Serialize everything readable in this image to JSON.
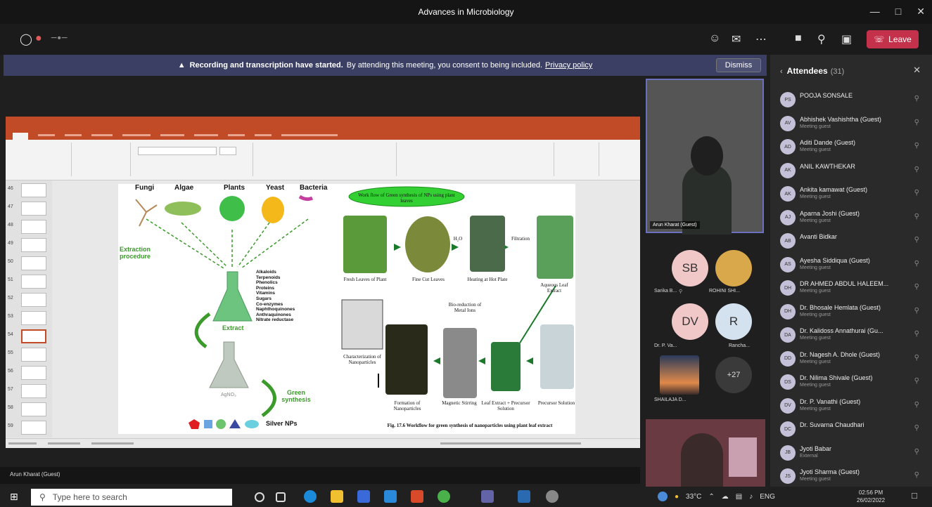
{
  "window": {
    "title": "Advances in Microbiology"
  },
  "toolbar": {
    "leave_label": "Leave"
  },
  "banner": {
    "bold_text": "Recording and transcription have started.",
    "text": "By attending this meeting, you consent to being included.",
    "link": "Privacy policy",
    "dismiss_label": "Dismiss"
  },
  "ppt": {
    "slide_numbers": [
      "46",
      "47",
      "48",
      "49",
      "50",
      "51",
      "52",
      "53",
      "54",
      "55",
      "56",
      "57",
      "58",
      "59"
    ],
    "slide": {
      "organisms": [
        "Fungi",
        "Algae",
        "Plants",
        "Yeast",
        "Bacteria"
      ],
      "extraction": "Extraction procedure",
      "compounds": [
        "Alkaloids",
        "Terpenoids",
        "Phenolics",
        "Proteins",
        "Vitamins",
        "Sugars",
        "Co-enzymes",
        "Naphthoquinones",
        "Anthraquinones",
        "Nitrate reductase"
      ],
      "extract_label": "Extract",
      "agno3": "AgNO₃",
      "green_synthesis": "Green synthesis",
      "silver_nps": "Silver NPs",
      "workflow_title": "Work flow of Green synthesis of NPs using plant leaves",
      "steps": {
        "fresh": "Fresh Leaves of Plant",
        "cut": "Fine Cut Leaves",
        "h2o": "H₂O",
        "heating": "Heating at Hot Plate",
        "filtration": "Filtration",
        "aqueous": "Aqueous Leaf Extract",
        "precursor": "Precursor Solution",
        "leaf_precursor": "Leaf Extract + Precursor Solution",
        "magnetic": "Magnetic Stirring",
        "formation": "Formation of Nanoparticles",
        "bioreduction": "Bio-reduction of Metal Ions",
        "characterization": "Characterization of Nanoparticles"
      },
      "caption": "Fig. 17.6 Workflow for green synthesis of nanoparticles using plant leaf extract"
    }
  },
  "participants": {
    "main_video_name": "Arun Kharat (Guest)",
    "sb_initials": "SB",
    "sb_name": "Sarika B...",
    "rohini_name": "ROHINI SHI...",
    "dv_initials": "DV",
    "dv_name": "Dr. P. Va...",
    "r_initials": "R",
    "r_name": "Rancha...",
    "shailaja_name": "SHAILAJA D...",
    "more_count": "+27"
  },
  "attendees": {
    "title": "Attendees",
    "count": "(31)",
    "list": [
      {
        "initials": "PS",
        "name": "POOJA SONSALE",
        "sub": ""
      },
      {
        "initials": "AV",
        "name": "Abhishek Vashishtha (Guest)",
        "sub": "Meeting guest"
      },
      {
        "initials": "AD",
        "name": "Aditi Dande (Guest)",
        "sub": "Meeting guest"
      },
      {
        "initials": "AK",
        "name": "ANIL KAWTHEKAR",
        "sub": ""
      },
      {
        "initials": "AK",
        "name": "Ankita kamawat (Guest)",
        "sub": "Meeting guest"
      },
      {
        "initials": "AJ",
        "name": "Aparna Joshi (Guest)",
        "sub": "Meeting guest"
      },
      {
        "initials": "AB",
        "name": "Avanti Bidkar",
        "sub": ""
      },
      {
        "initials": "AS",
        "name": "Ayesha Siddiqua (Guest)",
        "sub": "Meeting guest"
      },
      {
        "initials": "DH",
        "name": "DR AHMED ABDUL HALEEM...",
        "sub": "Meeting guest"
      },
      {
        "initials": "DH",
        "name": "Dr. Bhosale Hemlata (Guest)",
        "sub": "Meeting guest"
      },
      {
        "initials": "DA",
        "name": "Dr. Kalidoss Annathurai (Gu...",
        "sub": "Meeting guest"
      },
      {
        "initials": "DD",
        "name": "Dr. Nagesh A. Dhole (Guest)",
        "sub": "Meeting guest"
      },
      {
        "initials": "DS",
        "name": "Dr. Nilima Shivale (Guest)",
        "sub": "Meeting guest"
      },
      {
        "initials": "DV",
        "name": "Dr. P. Vanathi (Guest)",
        "sub": "Meeting guest"
      },
      {
        "initials": "DC",
        "name": "Dr. Suvarna Chaudhari",
        "sub": ""
      },
      {
        "initials": "JB",
        "name": "Jyoti Babar",
        "sub": "External"
      },
      {
        "initials": "JS",
        "name": "Jyoti Sharma (Guest)",
        "sub": "Meeting guest"
      }
    ]
  },
  "status_strip": {
    "name": "Arun Kharat (Guest)"
  },
  "taskbar": {
    "search_placeholder": "Type here to search",
    "temperature": "33°C",
    "lang": "ENG",
    "time": "02:56 PM",
    "date": "26/02/2022"
  }
}
